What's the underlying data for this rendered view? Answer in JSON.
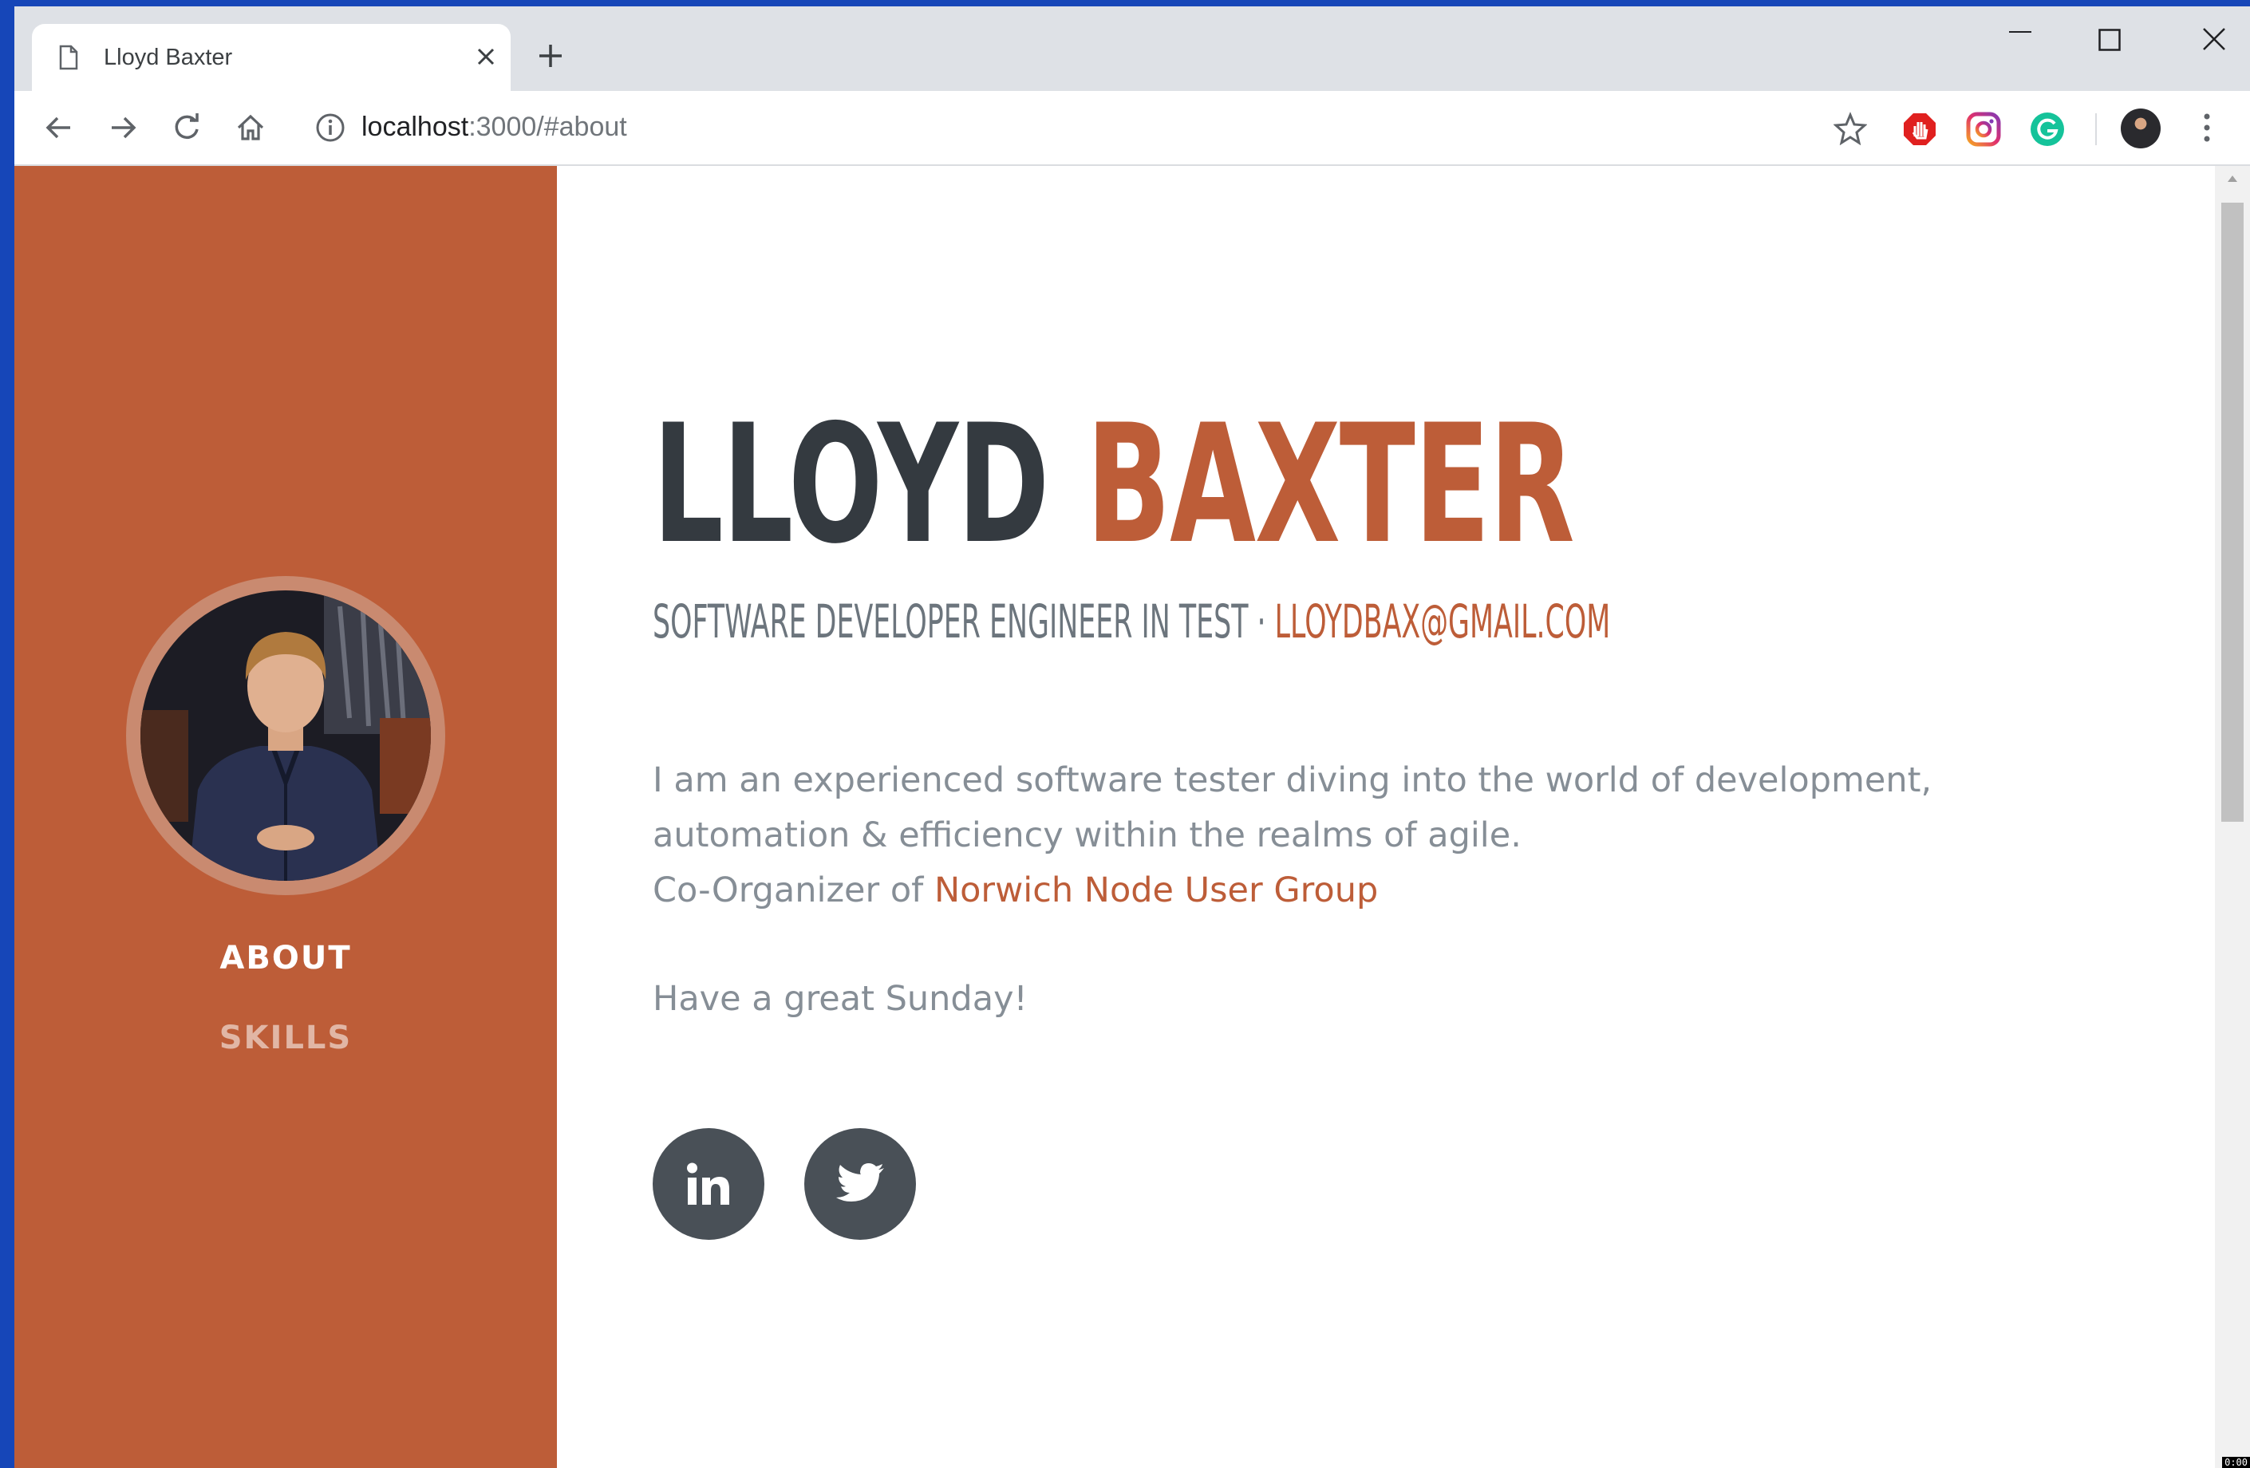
{
  "browser": {
    "tab_title": "Lloyd Baxter",
    "url_host": "localhost",
    "url_rest": ":3000/#about",
    "extensions": [
      "adblock-icon",
      "instagram-icon",
      "grammarly-icon"
    ]
  },
  "sidebar": {
    "nav": [
      {
        "label": "ABOUT",
        "active": true
      },
      {
        "label": "SKILLS",
        "active": false
      }
    ]
  },
  "about": {
    "first_name": "LLOYD",
    "last_name": "BAXTER",
    "role": "SOFTWARE DEVELOPER ENGINEER IN TEST · ",
    "email": "LLOYDBAX@GMAIL.COM",
    "bio_line1": "I am an experienced software tester diving into the world of development, automation & efficiency within the realms of agile.",
    "bio_line3_prefix": "Co-Organizer of ",
    "bio_link": "Norwich Node User Group",
    "greeting": "Have a great Sunday!"
  },
  "social": [
    {
      "name": "linkedin",
      "label": "in"
    },
    {
      "name": "twitter"
    }
  ],
  "colors": {
    "primary": "#bd5d38",
    "dark": "#343a40",
    "muted": "#868e96",
    "social_bg": "#495057"
  },
  "corner_label": "0:00"
}
